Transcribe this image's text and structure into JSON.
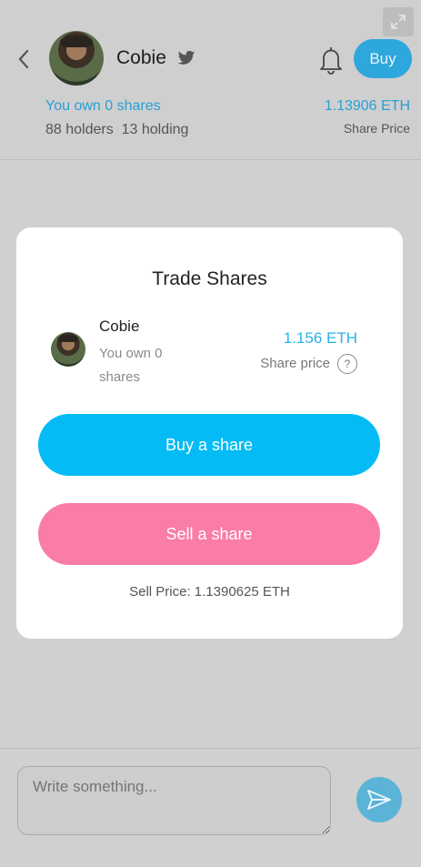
{
  "header": {
    "name": "Cobie",
    "buy_label": "Buy",
    "own_shares": "You own 0 shares",
    "holders": "88 holders  13 holding",
    "share_price_value": "1.13906 ETH",
    "share_price_label": "Share Price",
    "icons": [
      "expand-icon",
      "back-chevron-icon",
      "twitter-icon",
      "bell-icon"
    ]
  },
  "modal": {
    "title": "Trade Shares",
    "name": "Cobie",
    "own_text": "You own 0 shares",
    "price_value": "1.156 ETH",
    "price_label": "Share price",
    "help_symbol": "?",
    "buy_label": "Buy a share",
    "sell_label": "Sell a share",
    "sell_price": "Sell Price: 1.1390625 ETH"
  },
  "composer": {
    "placeholder": "Write something..."
  },
  "colors": {
    "accent_blue": "#05bbf5",
    "sell_pink": "#fa7ca8",
    "link_blue": "#2a9fd3",
    "overlay_gray": "#d0d0d0"
  }
}
